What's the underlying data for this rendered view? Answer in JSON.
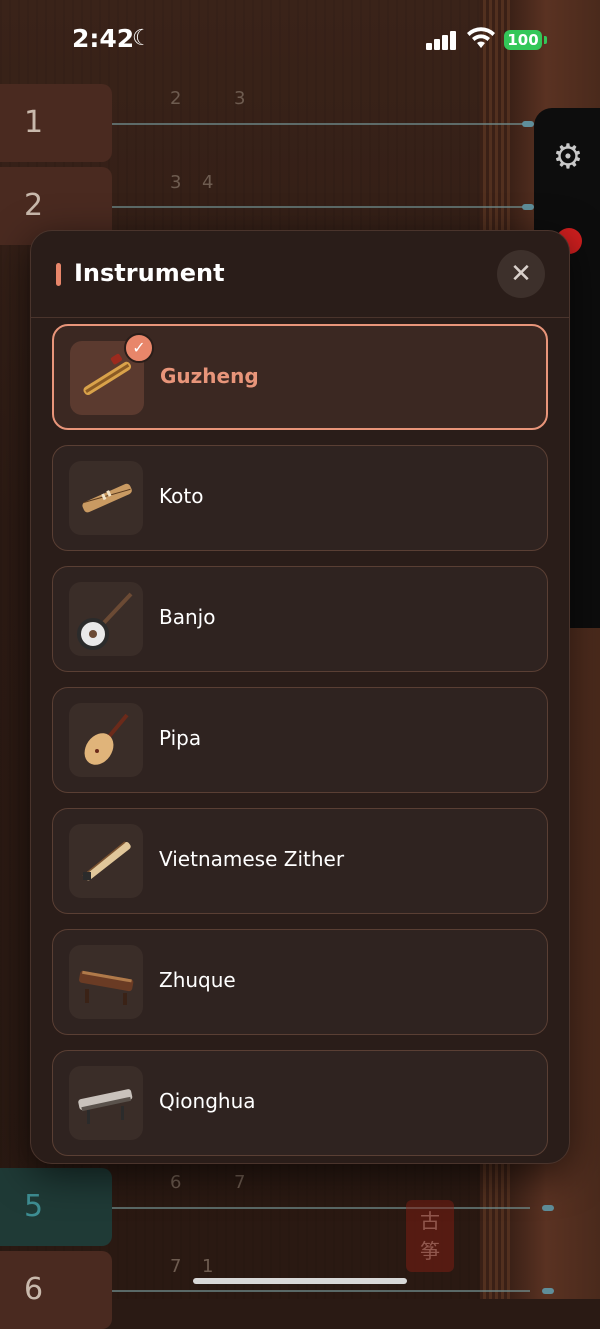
{
  "status_bar": {
    "time": "2:42",
    "battery": "100"
  },
  "background": {
    "key_tabs": [
      "1",
      "2",
      "5",
      "6"
    ],
    "note_numbers": [
      "2",
      "3",
      "3",
      "4",
      "6",
      "7",
      "7",
      "1"
    ],
    "stamp_text": [
      "古",
      "筝"
    ]
  },
  "modal": {
    "title": "Instrument",
    "close_icon": "close-icon",
    "items": [
      {
        "label": "Guzheng",
        "selected": true
      },
      {
        "label": "Koto",
        "selected": false
      },
      {
        "label": "Banjo",
        "selected": false
      },
      {
        "label": "Pipa",
        "selected": false
      },
      {
        "label": "Vietnamese Zither",
        "selected": false
      },
      {
        "label": "Zhuque",
        "selected": false
      },
      {
        "label": "Qionghua",
        "selected": false
      }
    ]
  },
  "colors": {
    "accent": "#e8866a",
    "selected_border": "#e8957a",
    "battery": "#34c759"
  }
}
